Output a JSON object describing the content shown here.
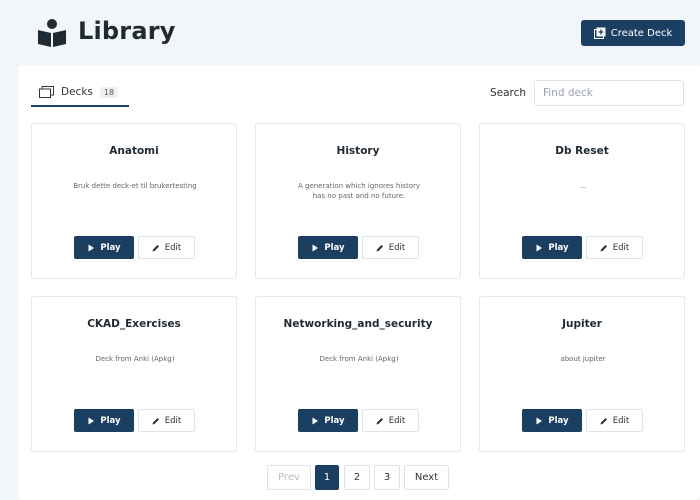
{
  "header": {
    "title": "Library",
    "create_label": "Create Deck"
  },
  "toolbar": {
    "tab_label": "Decks",
    "tab_count": "18",
    "search_label": "Search",
    "search_placeholder": "Find deck"
  },
  "decks": [
    {
      "title": "Anatomi",
      "description": "Bruk dette deck-et til brukertesting",
      "play": "Play",
      "edit": "Edit"
    },
    {
      "title": "History",
      "description": "A generation which ignores history has no past and no future.",
      "play": "Play",
      "edit": "Edit"
    },
    {
      "title": "Db Reset",
      "description": "...",
      "play": "Play",
      "edit": "Edit"
    },
    {
      "title": "CKAD_Exercises",
      "description": "Deck from Anki (Apkg)",
      "play": "Play",
      "edit": "Edit"
    },
    {
      "title": "Networking_and_security",
      "description": "Deck from Anki (Apkg)",
      "play": "Play",
      "edit": "Edit"
    },
    {
      "title": "Jupiter",
      "description": "about jupiter",
      "play": "Play",
      "edit": "Edit"
    }
  ],
  "pagination": {
    "prev": "Prev",
    "pages": [
      "1",
      "2",
      "3"
    ],
    "current": "1",
    "next": "Next"
  },
  "colors": {
    "primary": "#1b3f62",
    "background": "#f3f6f8"
  }
}
